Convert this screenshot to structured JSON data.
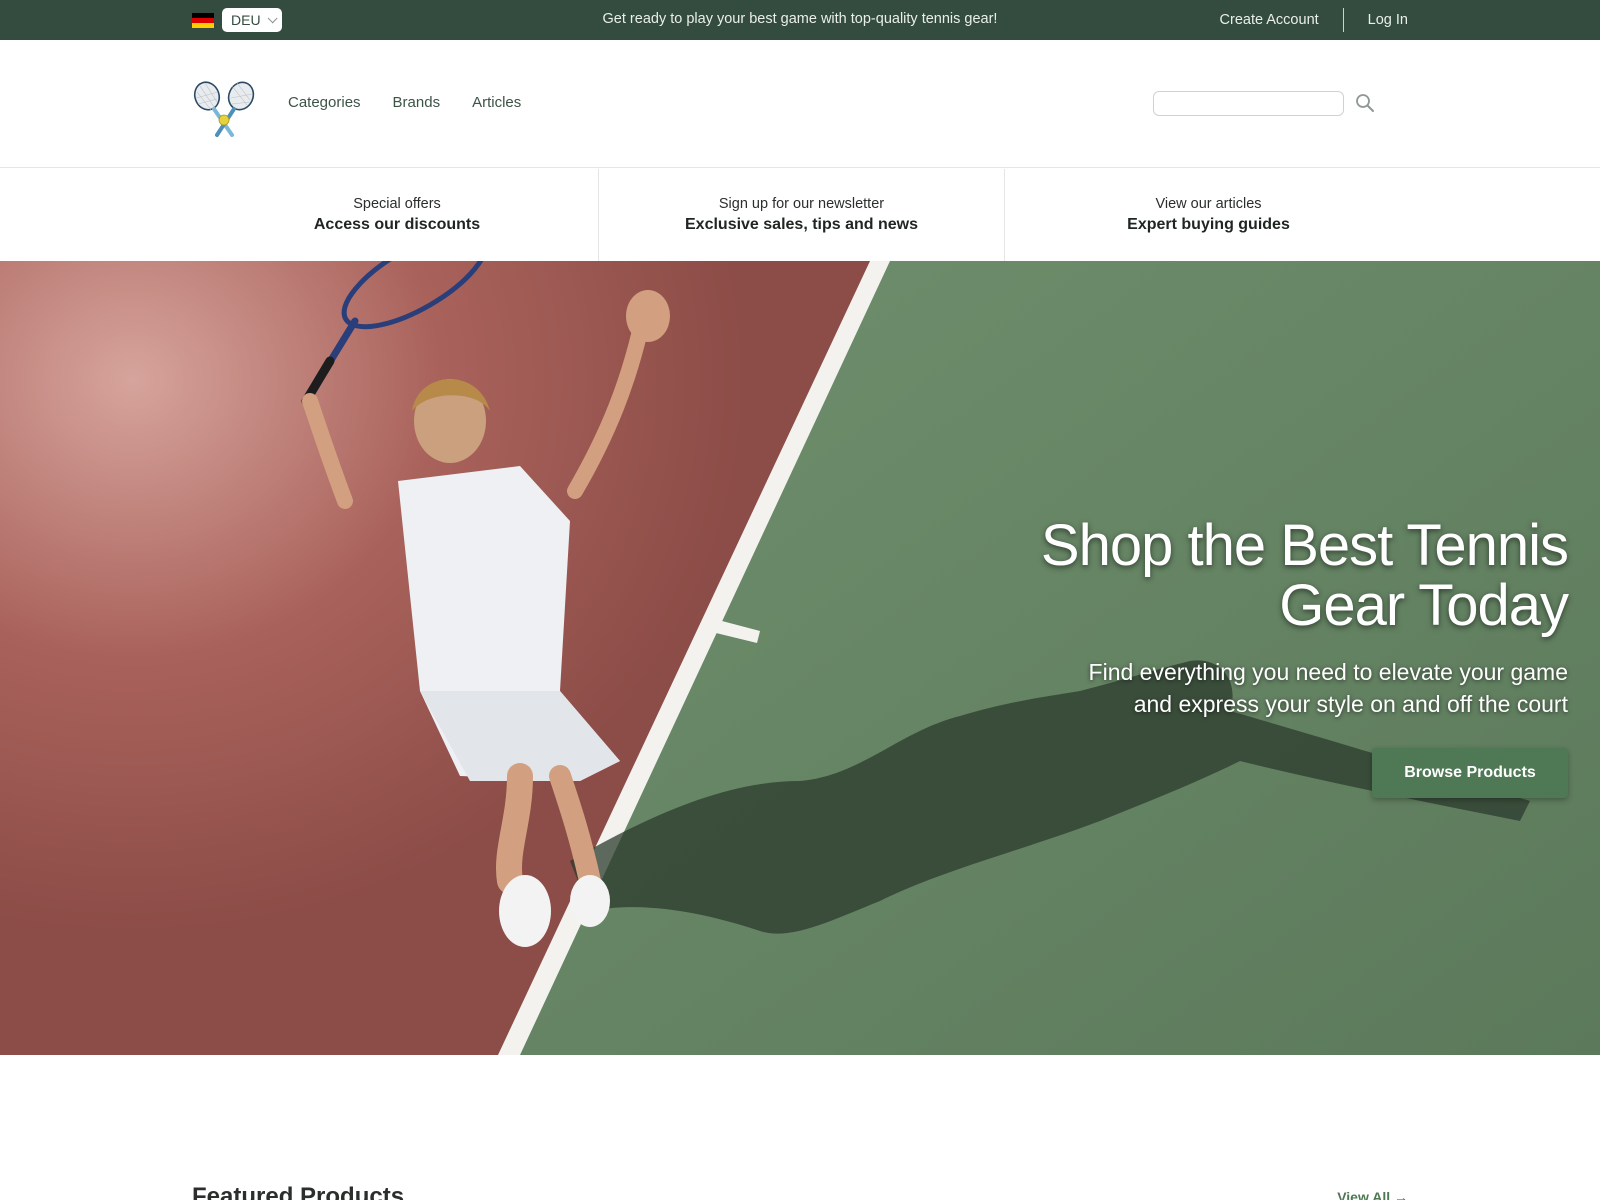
{
  "topbar": {
    "language_code": "DEU",
    "promo_text": "Get ready to play your best game with top-quality tennis gear!",
    "create_account": "Create Account",
    "log_in": "Log In",
    "flag_colors": [
      "#000000",
      "#dd0000",
      "#ffce00"
    ]
  },
  "header": {
    "logo_icon": "crossed-tennis-rackets",
    "nav": [
      {
        "label": "Categories"
      },
      {
        "label": "Brands"
      },
      {
        "label": "Articles"
      }
    ],
    "search": {
      "placeholder": "",
      "icon": "search-icon"
    }
  },
  "features": [
    {
      "sub": "Special offers",
      "main": "Access our discounts"
    },
    {
      "sub": "Sign up for our newsletter",
      "main": "Exclusive sales, tips and news"
    },
    {
      "sub": "View our articles",
      "main": "Expert buying guides"
    }
  ],
  "hero": {
    "title_line1": "Shop the Best Tennis",
    "title_line2": "Gear Today",
    "subtitle_line1": "Find everything you need to elevate your game",
    "subtitle_line2": "and express your style on and off the court",
    "button_label": "Browse Products"
  },
  "featured": {
    "title": "Featured Products",
    "view_all": "View All →"
  },
  "colors": {
    "topbar_bg": "#344b3f",
    "accent_green": "#4f7855",
    "clay_court": "#9c5a55",
    "green_court": "#6b8a69"
  }
}
